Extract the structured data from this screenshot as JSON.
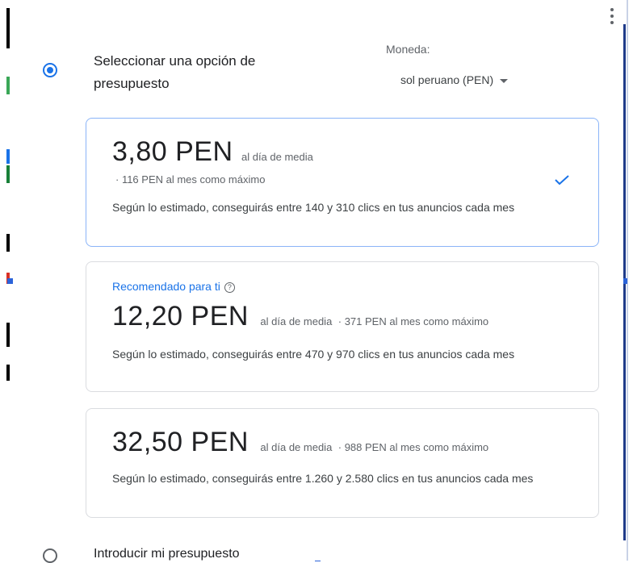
{
  "budget_option": {
    "title": "Seleccionar una opción de presupuesto",
    "currency_label": "Moneda:",
    "currency_value": "sol peruano (PEN)"
  },
  "cards": [
    {
      "amount": "3,80 PEN",
      "per_day": "al día de media",
      "max_month": "· 116 PEN al mes como máximo",
      "estimate": "Según lo estimado, conseguirás entre 140 y 310 clics en tus anuncios cada mes",
      "selected": true
    },
    {
      "recommended": "Recomendado para ti",
      "amount": "12,20 PEN",
      "per_day": "al día de media",
      "max_month": "· 371 PEN al mes como máximo",
      "estimate": "Según lo estimado, conseguirás entre 470 y 970 clics en tus anuncios cada mes"
    },
    {
      "amount": "32,50 PEN",
      "per_day": "al día de media",
      "max_month": "· 988 PEN al mes como máximo",
      "estimate": "Según lo estimado, conseguirás entre 1.260 y 2.580 clics en tus anuncios cada mes"
    }
  ],
  "custom_budget_label": "Introducir mi presupuesto",
  "icons": {
    "menu": "more-vert-icon",
    "check": "check-icon",
    "help": "help-icon",
    "dropdown": "caret-down-icon"
  },
  "colors": {
    "accent": "#1a73e8",
    "selected_border": "#8ab4f8"
  }
}
